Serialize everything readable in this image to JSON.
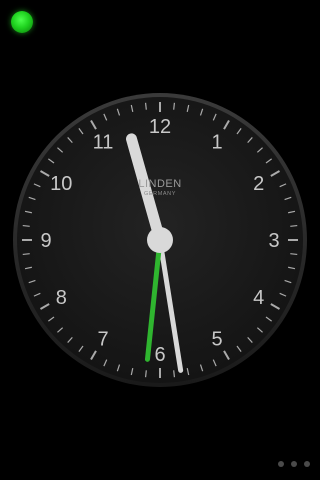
{
  "status": {
    "indicator_color": "#1fd21f"
  },
  "clock": {
    "numerals": [
      "12",
      "1",
      "2",
      "3",
      "4",
      "5",
      "6",
      "7",
      "8",
      "9",
      "10",
      "11"
    ],
    "brand_name": "LINDEN",
    "brand_sub": "GERMANY",
    "time": {
      "hour": 11,
      "minute": 28.5,
      "second": 31
    },
    "colors": {
      "face": "#1c1c1c",
      "hands": "#d9d9d9",
      "second_hand": "#2fb52f",
      "ticks": "#aaaaaa"
    }
  },
  "pager": {
    "dots": 3
  }
}
